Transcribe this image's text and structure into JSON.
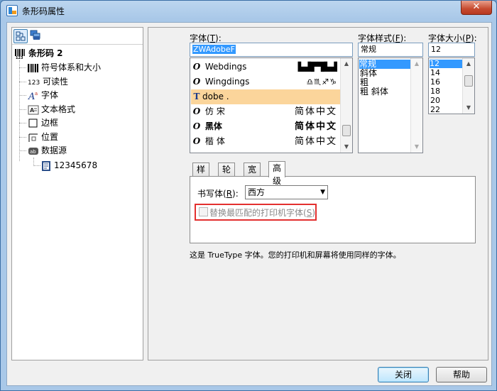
{
  "window": {
    "title": "条形码属性",
    "close_symbol": "✕"
  },
  "tree": {
    "root": "条形码 2",
    "items": [
      {
        "label": "符号体系和大小",
        "icon": "barcode-icon"
      },
      {
        "label": "可读性",
        "icon": "readable-123-icon",
        "prefix": "123"
      },
      {
        "label": "字体",
        "icon": "font-icon"
      },
      {
        "label": "文本格式",
        "icon": "text-format-icon"
      },
      {
        "label": "边框",
        "icon": "border-icon"
      },
      {
        "label": "位置",
        "icon": "position-icon"
      },
      {
        "label": "数据源",
        "icon": "datasource-icon"
      }
    ],
    "child": "12345678"
  },
  "font": {
    "label": "字体(",
    "label_key": "T",
    "label_end": "):",
    "value": "ZWAdobeF",
    "list": [
      {
        "name": "Webdings",
        "sample": "🏙🚲🐾"
      },
      {
        "name": "Wingdings",
        "sample": "♎♏♐♑"
      },
      {
        "name": "dobe .",
        "sample": ""
      },
      {
        "name": "仿宋",
        "sample": "简体中文"
      },
      {
        "name": "黑体",
        "sample": "简体中文"
      },
      {
        "name": "楷体",
        "sample": "简体中文"
      }
    ]
  },
  "style": {
    "label": "字体样式(",
    "label_key": "F",
    "label_end": "):",
    "value": "常规",
    "options": [
      "常规",
      "斜体",
      "粗",
      "粗 斜体"
    ]
  },
  "size": {
    "label": "字体大小(",
    "label_key": "P",
    "label_end": "):",
    "value": "12",
    "options": [
      "12",
      "14",
      "16",
      "18",
      "20",
      "22"
    ]
  },
  "tabs": [
    "样式",
    "轮廓",
    "宽度",
    "高级"
  ],
  "advanced": {
    "script_label": "书写体(",
    "script_key": "R",
    "script_end": "):",
    "script_value": "西方",
    "replace_label": "替换最匹配的打印机字体(",
    "replace_key": "S",
    "replace_end": ")"
  },
  "description": "这是 TrueType 字体。您的打印机和屏幕将使用同样的字体。",
  "buttons": {
    "close": "关闭",
    "help": "帮助"
  }
}
